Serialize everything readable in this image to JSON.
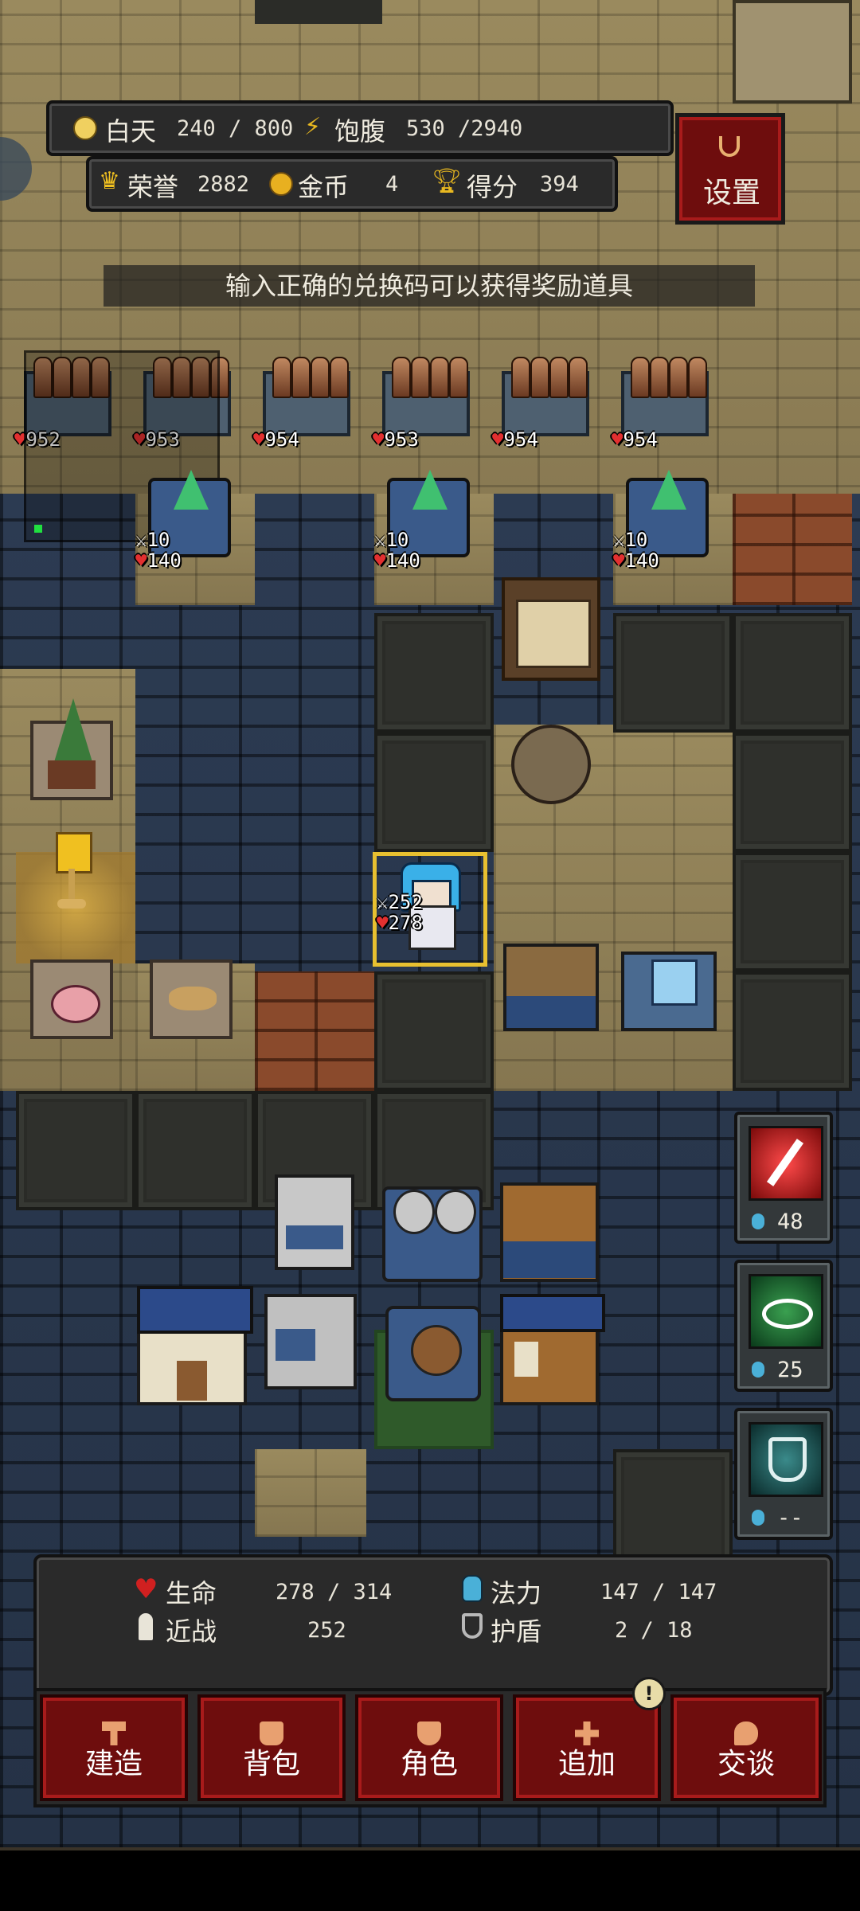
{
  "status": {
    "day_label": "白天",
    "day_value": "240 / 800",
    "hunger_label": "饱腹",
    "hunger_value": "530 /2940",
    "honor_label": "荣誉",
    "honor_value": "2882",
    "gold_label": "金币",
    "gold_value": "4",
    "score_label": "得分",
    "score_value": "394",
    "settings_label": "设置"
  },
  "notice": "输入正确的兑换码可以获得奖励道具",
  "walls": [
    "952",
    "953",
    "954",
    "953",
    "954",
    "954"
  ],
  "turrets": [
    {
      "atk": "10",
      "hp": "140"
    },
    {
      "atk": "10",
      "hp": "140"
    },
    {
      "atk": "10",
      "hp": "140"
    }
  ],
  "player": {
    "atk": "252",
    "hp": "278"
  },
  "skills": [
    {
      "name": "red-sword-skill",
      "cost": "48"
    },
    {
      "name": "green-eye-skill",
      "cost": "25"
    },
    {
      "name": "shield-skill",
      "cost": "--"
    }
  ],
  "stats": {
    "hp_label": "生命",
    "hp_value": "278 / 314",
    "mp_label": "法力",
    "mp_value": "147 / 147",
    "melee_label": "近战",
    "melee_value": "252",
    "armor_label": "护盾",
    "armor_value": "2  /  18"
  },
  "menu": {
    "build": "建造",
    "bag": "背包",
    "character": "角色",
    "add": "追加",
    "talk": "交谈"
  },
  "colors": {
    "accent_red": "#6e0d0d",
    "heart": "#e23030",
    "mana": "#4ab0d8",
    "highlight": "#e8c030"
  }
}
